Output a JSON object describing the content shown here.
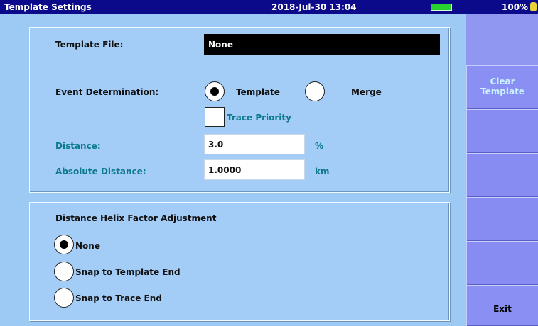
{
  "titlebar": {
    "title": "Template Settings",
    "datetime": "2018-Jul-30 13:04",
    "battery_percent": "100%"
  },
  "template_file": {
    "label": "Template File:",
    "value": "None"
  },
  "event_determination": {
    "label": "Event Determination:",
    "options": [
      "Template",
      "Merge"
    ],
    "selected": "Template",
    "trace_priority_label": "Trace Priority",
    "trace_priority_checked": false,
    "distance_label": "Distance:",
    "distance_value": "3.0",
    "distance_unit": "%",
    "abs_distance_label": "Absolute Distance:",
    "abs_distance_value": "1.0000",
    "abs_distance_unit": "km"
  },
  "helix": {
    "heading": "Distance Helix Factor Adjustment",
    "options": [
      "None",
      "Snap to Template End",
      "Snap to Trace End"
    ],
    "selected": "None"
  },
  "softkeys": {
    "clear_template_line1": "Clear",
    "clear_template_line2": "Template",
    "exit": "Exit"
  },
  "colors": {
    "titlebar": "#0a0a8a",
    "background": "#9dc9f5",
    "softkey": "#8a8ff4",
    "accent_text": "#0c7a8c",
    "battery": "#29d12e"
  }
}
